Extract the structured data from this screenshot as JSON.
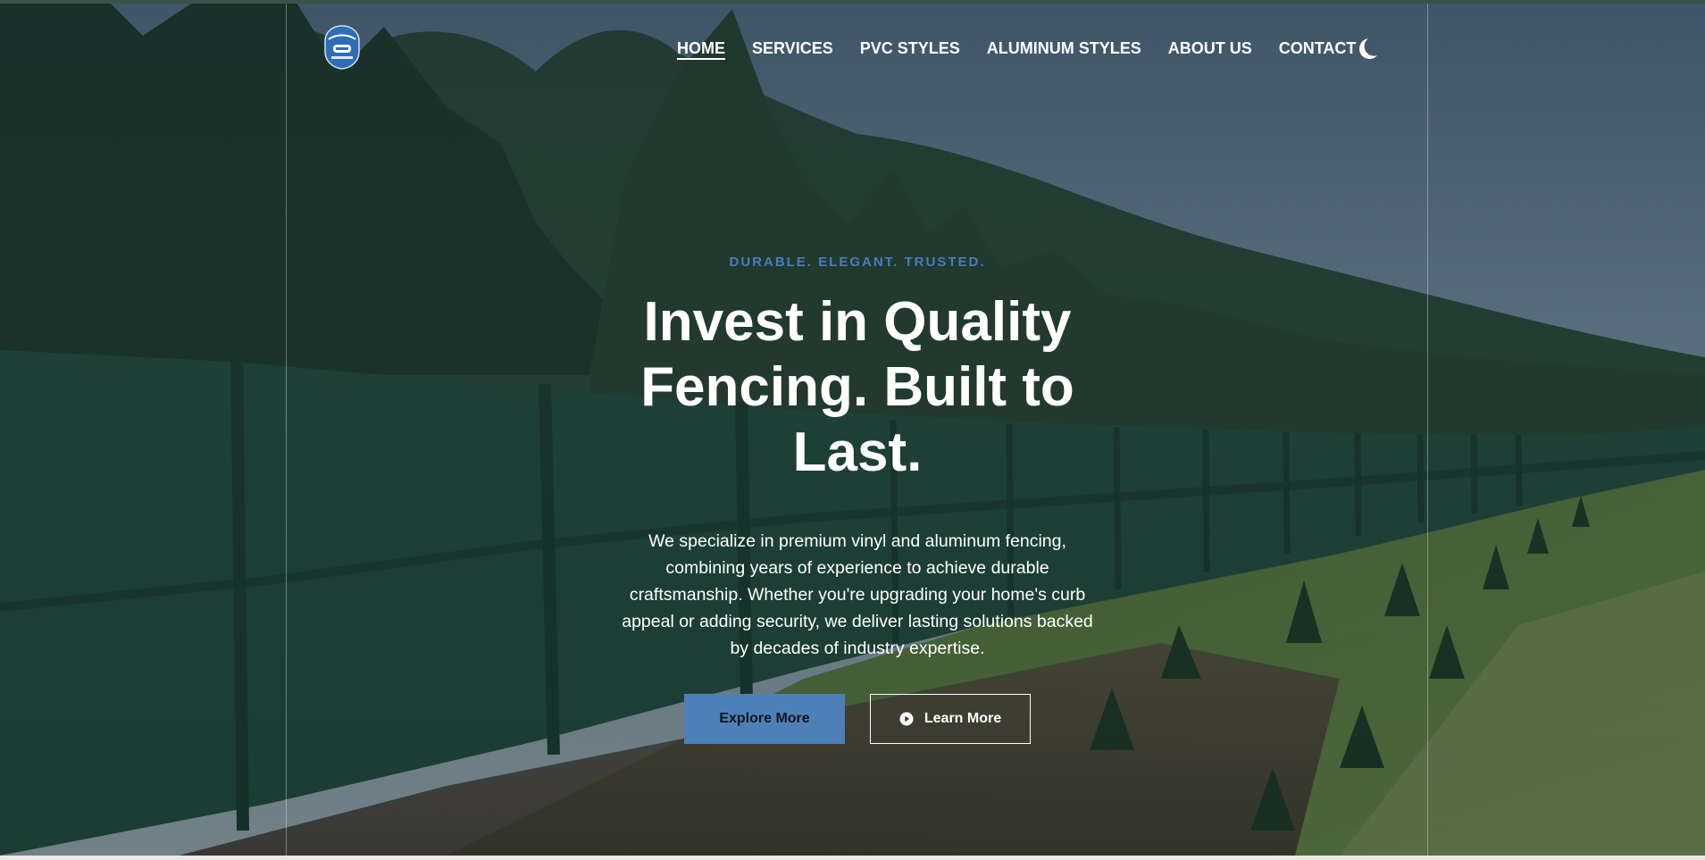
{
  "brand": {
    "logo_icon": "signature-sfp-products-badge-icon"
  },
  "nav": {
    "items": [
      {
        "label": "HOME",
        "active": true
      },
      {
        "label": "SERVICES",
        "active": false
      },
      {
        "label": "PVC STYLES",
        "active": false
      },
      {
        "label": "ALUMINUM STYLES",
        "active": false
      },
      {
        "label": "ABOUT US",
        "active": false
      },
      {
        "label": "CONTACT",
        "active": false
      }
    ],
    "theme_toggle_icon": "moon-icon"
  },
  "hero": {
    "tagline": "DURABLE. ELEGANT. TRUSTED.",
    "headline_line1": "Invest in Quality",
    "headline_line2": "Fencing. Built to",
    "headline_line3": "Last.",
    "intro_line1": "We specialize in premium vinyl and aluminum fencing,",
    "intro_line2": "combining years of experience to achieve durable",
    "intro_line3": "craftsmanship. Whether you're upgrading your home's curb",
    "intro_line4": "appeal or adding security, we deliver lasting solutions backed",
    "intro_line5": "by decades of industry expertise.",
    "primary_button": "Explore More",
    "secondary_button": "Learn More",
    "secondary_button_icon": "play-circle-icon"
  },
  "colors": {
    "accent": "#4e7fb7",
    "tagline": "#4a7cc0",
    "fence_green": "#234e3f",
    "text": "#ffffff"
  }
}
